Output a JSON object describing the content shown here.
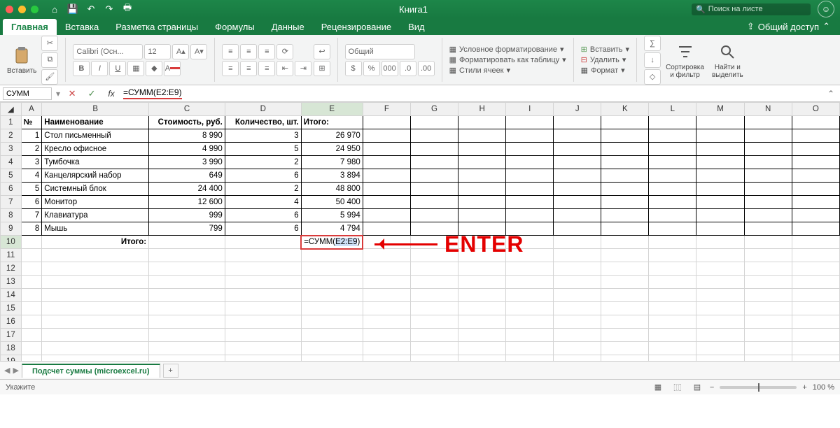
{
  "titlebar": {
    "title": "Книга1",
    "search_placeholder": "Поиск на листе"
  },
  "tabs": {
    "items": [
      "Главная",
      "Вставка",
      "Разметка страницы",
      "Формулы",
      "Данные",
      "Рецензирование",
      "Вид"
    ],
    "share": "Общий доступ"
  },
  "ribbon": {
    "paste": "Вставить",
    "font_name": "Calibri (Осн...",
    "font_size": "12",
    "number_format": "Общий",
    "cond_fmt": "Условное форматирование",
    "fmt_table": "Форматировать как таблицу",
    "cell_styles": "Стили ячеек",
    "insert": "Вставить",
    "delete": "Удалить",
    "format": "Формат",
    "sort_filter": "Сортировка\nи фильтр",
    "find_select": "Найти и\nвыделить"
  },
  "formula_bar": {
    "name_box": "СУММ",
    "formula": "=СУММ(E2:E9)"
  },
  "columns": [
    "A",
    "B",
    "C",
    "D",
    "E",
    "F",
    "G",
    "H",
    "I",
    "J",
    "K",
    "L",
    "M",
    "N",
    "O"
  ],
  "headers": {
    "a": "№",
    "b": "Наименование",
    "c": "Стоимость, руб.",
    "d": "Количество, шт.",
    "e": "Итого:"
  },
  "rows": [
    {
      "n": "1",
      "name": "Стол письменный",
      "cost": "8 990",
      "qty": "3",
      "total": "26 970"
    },
    {
      "n": "2",
      "name": "Кресло офисное",
      "cost": "4 990",
      "qty": "5",
      "total": "24 950"
    },
    {
      "n": "3",
      "name": "Тумбочка",
      "cost": "3 990",
      "qty": "2",
      "total": "7 980"
    },
    {
      "n": "4",
      "name": "Канцелярский набор",
      "cost": "649",
      "qty": "6",
      "total": "3 894"
    },
    {
      "n": "5",
      "name": "Системный блок",
      "cost": "24 400",
      "qty": "2",
      "total": "48 800"
    },
    {
      "n": "6",
      "name": "Монитор",
      "cost": "12 600",
      "qty": "4",
      "total": "50 400"
    },
    {
      "n": "7",
      "name": "Клавиатура",
      "cost": "999",
      "qty": "6",
      "total": "5 994"
    },
    {
      "n": "8",
      "name": "Мышь",
      "cost": "799",
      "qty": "6",
      "total": "4 794"
    }
  ],
  "total_row": {
    "label": "Итого:",
    "formula_prefix": "=СУММ(",
    "formula_range": "E2:E9",
    "formula_suffix": ")"
  },
  "annotation": "ENTER",
  "sheet_tab": "Подсчет суммы (microexcel.ru)",
  "status": {
    "left": "Укажите",
    "zoom": "100 %"
  }
}
